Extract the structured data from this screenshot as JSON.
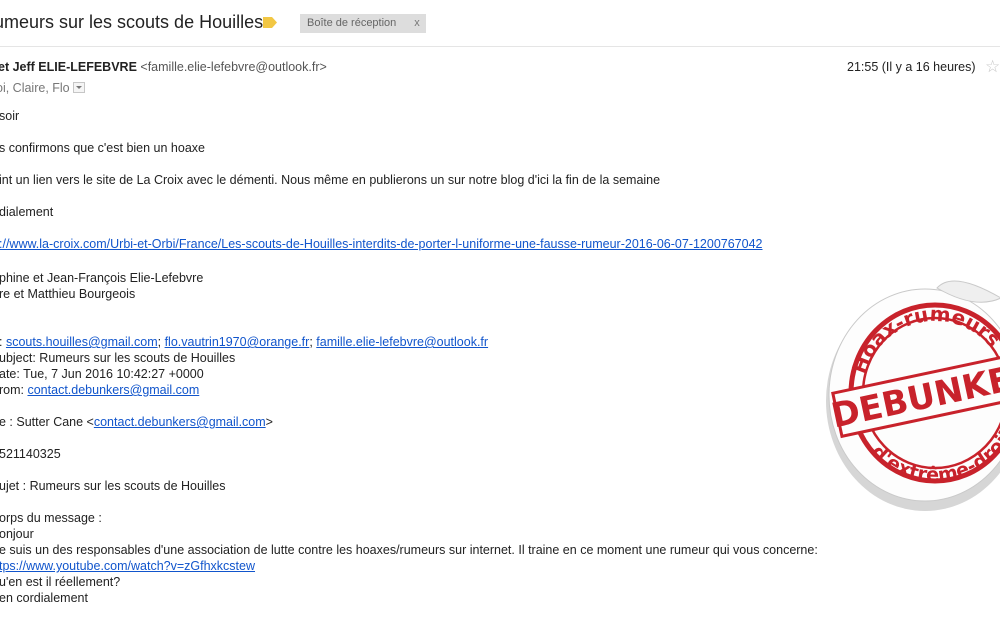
{
  "subject": "umeurs sur les scouts de Houilles",
  "label_chip": {
    "text": "Boîte de réception",
    "close": "x"
  },
  "sender": {
    "name": "et Jeff ELIE-LEFEBVRE",
    "email": "<famille.elie-lefebvre@outlook.fr>"
  },
  "recipients": "oi, Claire, Flo",
  "date": "21:55 (Il y a 16 heures)",
  "body": {
    "greeting": "soir",
    "p1": "s confirmons que c'est bien un hoaxe",
    "p2": "int un lien vers le site de La Croix avec le démenti. Nous même en publierons un sur notre blog d'ici la fin de la semaine",
    "p3": "dialement",
    "link": "://www.la-croix.com/Urbi-et-Orbi/France/Les-scouts-de-Houilles-interdits-de-porter-l-uniforme-une-fausse-rumeur-2016-06-07-1200767042",
    "sig1": "phine et Jean-François Elie-Lefebvre",
    "sig2": "re et Matthieu Bourgeois"
  },
  "quoted": {
    "to_prefix": ":",
    "to_1": "scouts.houilles@gmail.com",
    "to_2": "flo.vautrin1970@orange.fr",
    "to_3": "famille.elie-lefebvre@outlook.fr",
    "sep": ";",
    "subject_line": "ubject: Rumeurs sur les scouts de Houilles",
    "date_line": "ate: Tue, 7 Jun 2016 10:42:27 +0000",
    "from_prefix": "rom:",
    "from_email": "contact.debunkers@gmail.com",
    "name_prefix": "e : Sutter Cane <",
    "name_email": "contact.debunkers@gmail.com",
    "name_suffix": ">",
    "number": "521140325",
    "sujet": "ujet : Rumeurs sur les scouts de Houilles",
    "corps": "orps du message :",
    "bonjour": "onjour",
    "message": "e suis un des responsables d'une association de lutte contre les hoaxes/rumeurs sur internet. Il traine en ce moment une rumeur qui vous concerne:",
    "yt_link": "tps://www.youtube.com/watch?v=zGfhxkcstew",
    "question": "u'en est il réellement?",
    "closing": "en cordialement"
  },
  "stamp": {
    "top_text": "Hoax-rumeurs",
    "center_text": "DEBUNKED",
    "bottom_text": "d'extrême-droite"
  },
  "colors": {
    "link": "#1155cc",
    "stamp_red": "#c8222b",
    "label_tag": "#f2c744"
  },
  "icons": {
    "label_tag": "label-tag-icon",
    "star": "star-icon",
    "dropdown": "chevron-down-icon"
  }
}
